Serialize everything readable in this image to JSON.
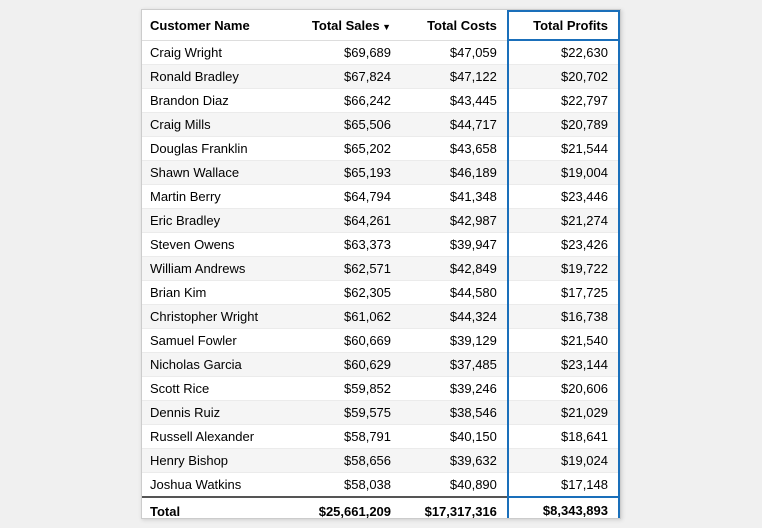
{
  "table": {
    "columns": [
      {
        "id": "name",
        "label": "Customer Name",
        "sorted": false,
        "highlighted": false
      },
      {
        "id": "sales",
        "label": "Total Sales",
        "sorted": true,
        "highlighted": false
      },
      {
        "id": "costs",
        "label": "Total Costs",
        "sorted": false,
        "highlighted": false
      },
      {
        "id": "profits",
        "label": "Total Profits",
        "sorted": false,
        "highlighted": true
      }
    ],
    "rows": [
      {
        "name": "Craig Wright",
        "sales": "$69,689",
        "costs": "$47,059",
        "profits": "$22,630"
      },
      {
        "name": "Ronald Bradley",
        "sales": "$67,824",
        "costs": "$47,122",
        "profits": "$20,702"
      },
      {
        "name": "Brandon Diaz",
        "sales": "$66,242",
        "costs": "$43,445",
        "profits": "$22,797"
      },
      {
        "name": "Craig Mills",
        "sales": "$65,506",
        "costs": "$44,717",
        "profits": "$20,789"
      },
      {
        "name": "Douglas Franklin",
        "sales": "$65,202",
        "costs": "$43,658",
        "profits": "$21,544"
      },
      {
        "name": "Shawn Wallace",
        "sales": "$65,193",
        "costs": "$46,189",
        "profits": "$19,004"
      },
      {
        "name": "Martin Berry",
        "sales": "$64,794",
        "costs": "$41,348",
        "profits": "$23,446"
      },
      {
        "name": "Eric Bradley",
        "sales": "$64,261",
        "costs": "$42,987",
        "profits": "$21,274"
      },
      {
        "name": "Steven Owens",
        "sales": "$63,373",
        "costs": "$39,947",
        "profits": "$23,426"
      },
      {
        "name": "William Andrews",
        "sales": "$62,571",
        "costs": "$42,849",
        "profits": "$19,722"
      },
      {
        "name": "Brian Kim",
        "sales": "$62,305",
        "costs": "$44,580",
        "profits": "$17,725"
      },
      {
        "name": "Christopher Wright",
        "sales": "$61,062",
        "costs": "$44,324",
        "profits": "$16,738"
      },
      {
        "name": "Samuel Fowler",
        "sales": "$60,669",
        "costs": "$39,129",
        "profits": "$21,540"
      },
      {
        "name": "Nicholas Garcia",
        "sales": "$60,629",
        "costs": "$37,485",
        "profits": "$23,144"
      },
      {
        "name": "Scott Rice",
        "sales": "$59,852",
        "costs": "$39,246",
        "profits": "$20,606"
      },
      {
        "name": "Dennis Ruiz",
        "sales": "$59,575",
        "costs": "$38,546",
        "profits": "$21,029"
      },
      {
        "name": "Russell Alexander",
        "sales": "$58,791",
        "costs": "$40,150",
        "profits": "$18,641"
      },
      {
        "name": "Henry Bishop",
        "sales": "$58,656",
        "costs": "$39,632",
        "profits": "$19,024"
      },
      {
        "name": "Joshua Watkins",
        "sales": "$58,038",
        "costs": "$40,890",
        "profits": "$17,148"
      }
    ],
    "totals": {
      "label": "Total",
      "sales": "$25,661,209",
      "costs": "$17,317,316",
      "profits": "$8,343,893"
    }
  }
}
